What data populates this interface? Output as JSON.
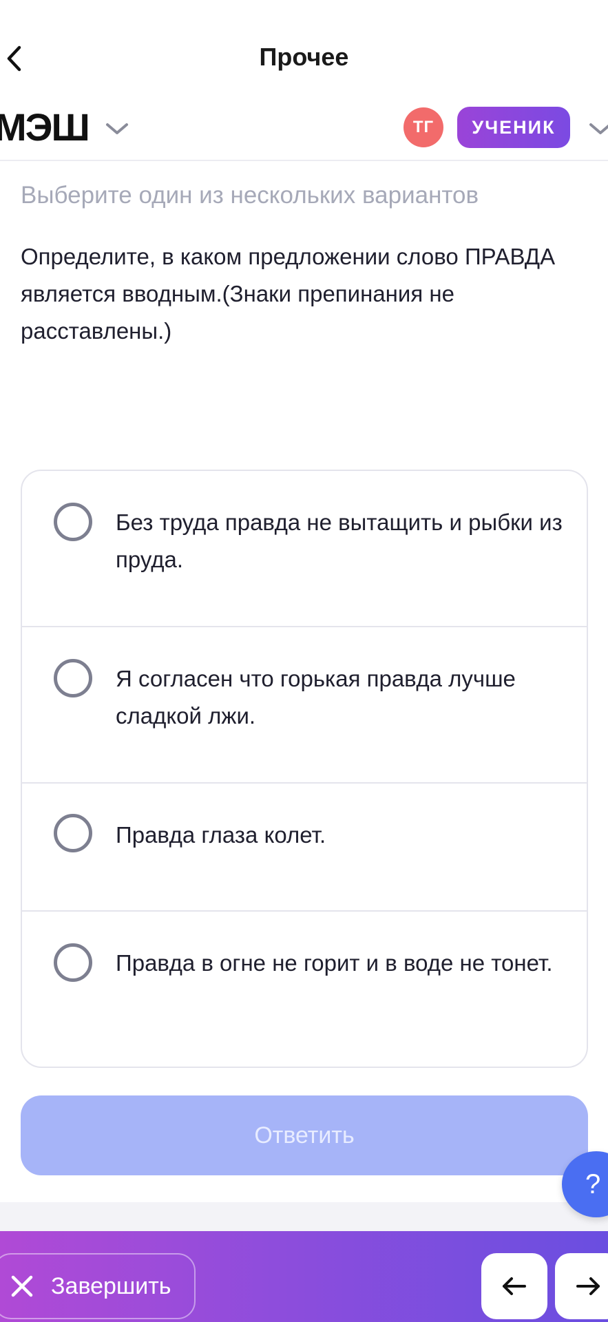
{
  "nav": {
    "title": "Прочее",
    "back_icon": "chevron-left-icon"
  },
  "app_header": {
    "logo": "МЭШ",
    "logo_menu_icon": "chevron-down-icon",
    "avatar_initials": "ТГ",
    "role_label": "УЧЕНИК",
    "role_menu_icon": "chevron-down-icon"
  },
  "task": {
    "hint": "Выберите один из нескольких вариантов",
    "question": "Определите, в каком предложении слово ПРАВДА является вводным.(Знаки препинания не расставлены.)",
    "options": [
      {
        "text": "Без труда правда не вытащить и рыбки из пруда.",
        "selected": false
      },
      {
        "text": "Я согласен что горькая правда лучше сладкой лжи.",
        "selected": false
      },
      {
        "text": "Правда глаза колет.",
        "selected": false
      },
      {
        "text": "Правда в огне не горит и в воде не тонет.",
        "selected": false
      }
    ],
    "answer_label": "Ответить"
  },
  "help": {
    "label": "?"
  },
  "bottom_bar": {
    "finish_label": "Завершить",
    "finish_icon": "close-icon",
    "prev_icon": "arrow-left-icon",
    "next_icon": "arrow-right-icon"
  },
  "colors": {
    "accent_purple": "#8e4ddc",
    "answer_disabled": "#a6b4f8",
    "help_blue": "#4a6ef2",
    "avatar_red": "#f26b6b"
  }
}
